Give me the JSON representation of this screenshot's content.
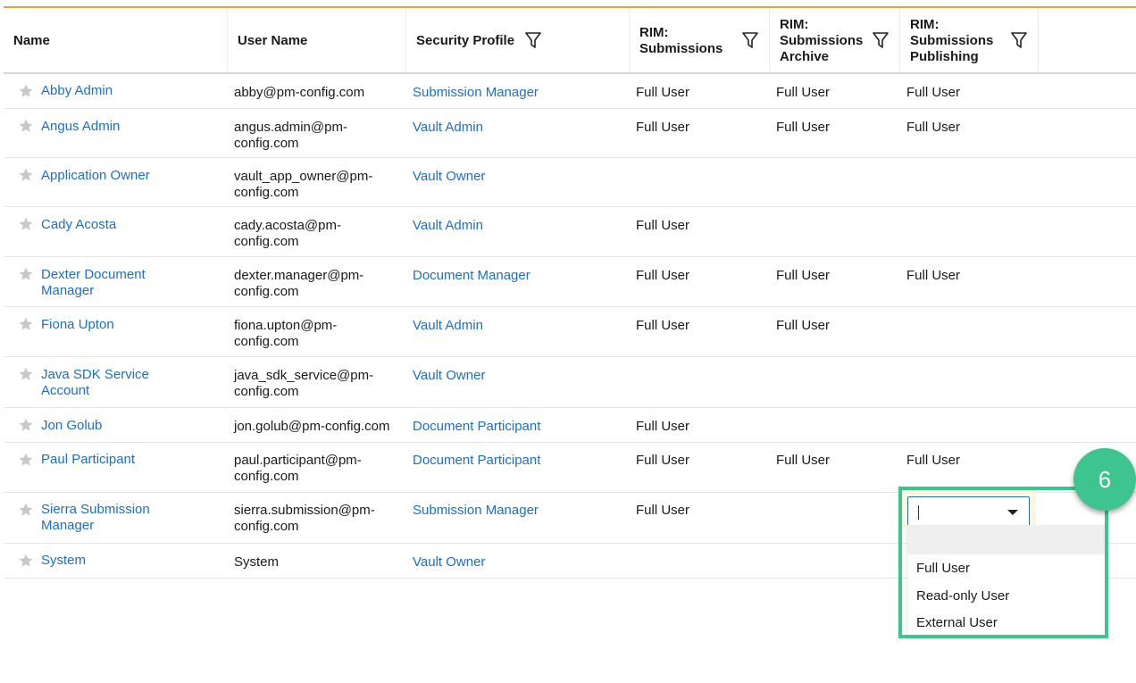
{
  "colors": {
    "accent": "#f0a030",
    "link": "#1b6fc4",
    "callout": "#3ec48e"
  },
  "table": {
    "headers": {
      "name": "Name",
      "username": "User Name",
      "profile": "Security Profile",
      "sub_l1": "RIM:",
      "sub_l2": "Submissions",
      "arch_l1": "RIM:",
      "arch_l2": "Submissions",
      "arch_l3": "Archive",
      "pub_l1": "RIM:",
      "pub_l2": "Submissions",
      "pub_l3": "Publishing"
    },
    "rows": [
      {
        "name1": "Abby Admin",
        "name2": "",
        "user1": "abby@pm-config.com",
        "user2": "",
        "profile": "Submission Manager",
        "sub": "Full User",
        "arch": "Full User",
        "pub": "Full User"
      },
      {
        "name1": "Angus Admin",
        "name2": "",
        "user1": "angus.admin@pm-",
        "user2": "config.com",
        "profile": "Vault Admin",
        "sub": "Full User",
        "arch": "Full User",
        "pub": "Full User"
      },
      {
        "name1": "Application Owner",
        "name2": "",
        "user1": "vault_app_owner@pm-",
        "user2": "config.com",
        "profile": "Vault Owner",
        "sub": "",
        "arch": "",
        "pub": ""
      },
      {
        "name1": "Cady Acosta",
        "name2": "",
        "user1": "cady.acosta@pm-",
        "user2": "config.com",
        "profile": "Vault Admin",
        "sub": "Full User",
        "arch": "",
        "pub": ""
      },
      {
        "name1": "Dexter Document",
        "name2": "Manager",
        "user1": "dexter.manager@pm-",
        "user2": "config.com",
        "profile": "Document Manager",
        "sub": "Full User",
        "arch": "Full User",
        "pub": "Full User"
      },
      {
        "name1": "Fiona Upton",
        "name2": "",
        "user1": "fiona.upton@pm-",
        "user2": "config.com",
        "profile": "Vault Admin",
        "sub": "Full User",
        "arch": "Full User",
        "pub": ""
      },
      {
        "name1": "Java SDK Service",
        "name2": "Account",
        "user1": "java_sdk_service@pm-",
        "user2": "config.com",
        "profile": "Vault Owner",
        "sub": "",
        "arch": "",
        "pub": ""
      },
      {
        "name1": "Jon Golub",
        "name2": "",
        "user1": "jon.golub@pm-config.com",
        "user2": "",
        "profile": "Document Participant",
        "sub": "Full User",
        "arch": "",
        "pub": ""
      },
      {
        "name1": "Paul Participant",
        "name2": "",
        "user1": "paul.participant@pm-",
        "user2": "config.com",
        "profile": "Document Participant",
        "sub": "Full User",
        "arch": "Full User",
        "pub": "Full User"
      },
      {
        "name1": "Sierra Submission",
        "name2": "Manager",
        "user1": "sierra.submission@pm-",
        "user2": "config.com",
        "profile": "Submission Manager",
        "sub": "Full User",
        "arch": "",
        "pub": ""
      },
      {
        "name1": "System",
        "name2": "",
        "user1": "System",
        "user2": "",
        "profile": "Vault Owner",
        "sub": "",
        "arch": "",
        "pub": ""
      }
    ]
  },
  "dropdown": {
    "value": "",
    "options": [
      "",
      "Full User",
      "Read-only User",
      "External User"
    ]
  },
  "callout": {
    "number": "6"
  }
}
